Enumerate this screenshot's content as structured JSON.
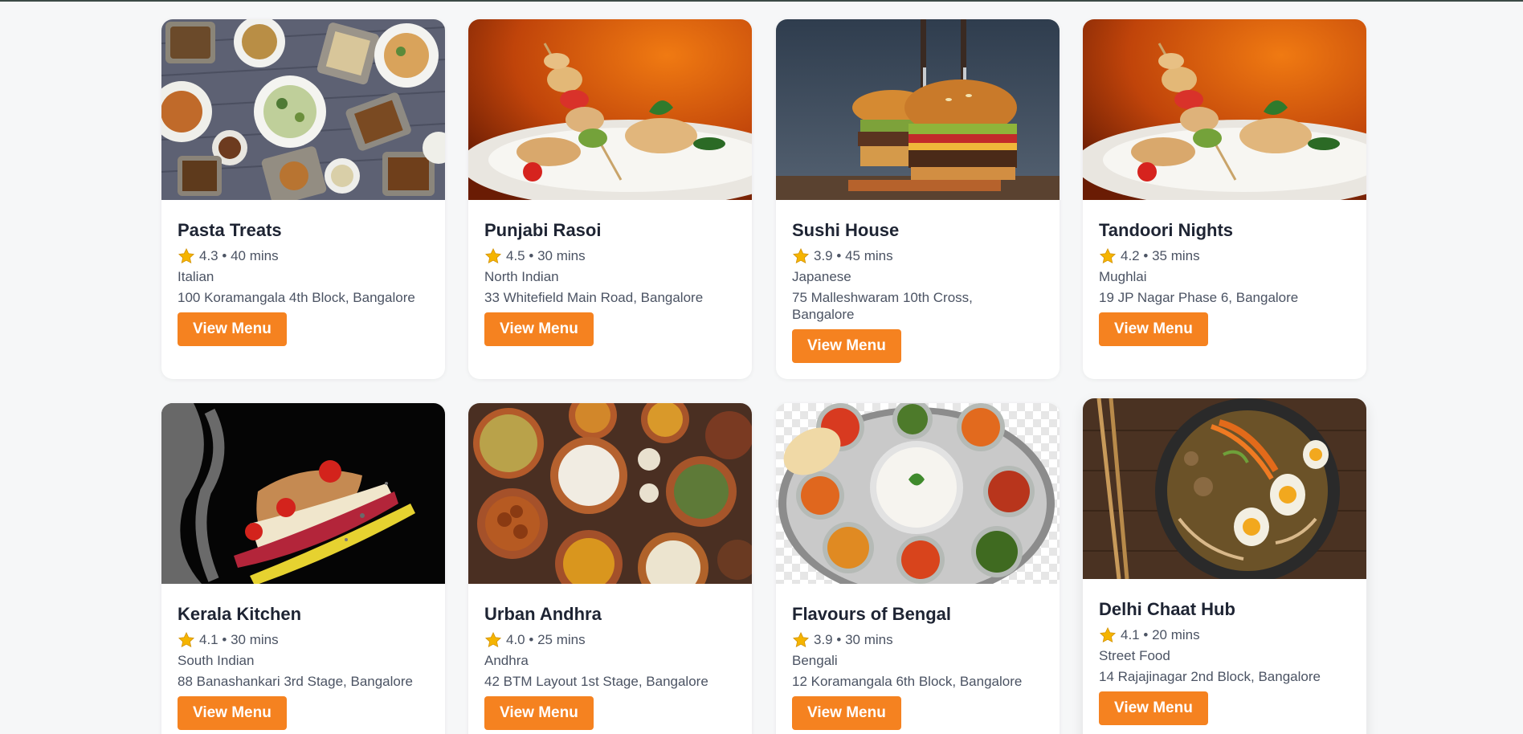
{
  "restaurants": [
    {
      "name": "Pasta Treats",
      "rating": "4.3",
      "time": "40 mins",
      "cuisine": "Italian",
      "address": "100 Koramangala 4th Block, Bangalore",
      "button": "View Menu"
    },
    {
      "name": "Punjabi Rasoi",
      "rating": "4.5",
      "time": "30 mins",
      "cuisine": "North Indian",
      "address": "33 Whitefield Main Road, Bangalore",
      "button": "View Menu"
    },
    {
      "name": "Sushi House",
      "rating": "3.9",
      "time": "45 mins",
      "cuisine": "Japanese",
      "address": "75 Malleshwaram 10th Cross, Bangalore",
      "button": "View Menu"
    },
    {
      "name": "Tandoori Nights",
      "rating": "4.2",
      "time": "35 mins",
      "cuisine": "Mughlai",
      "address": "19 JP Nagar Phase 6, Bangalore",
      "button": "View Menu"
    },
    {
      "name": "Kerala Kitchen",
      "rating": "4.1",
      "time": "30 mins",
      "cuisine": "South Indian",
      "address": "88 Banashankari 3rd Stage, Bangalore",
      "button": "View Menu"
    },
    {
      "name": "Urban Andhra",
      "rating": "4.0",
      "time": "25 mins",
      "cuisine": "Andhra",
      "address": "42 BTM Layout 1st Stage, Bangalore",
      "button": "View Menu"
    },
    {
      "name": "Flavours of Bengal",
      "rating": "3.9",
      "time": "30 mins",
      "cuisine": "Bengali",
      "address": "12 Koramangala 6th Block, Bangalore",
      "button": "View Menu"
    },
    {
      "name": "Delhi Chaat Hub",
      "rating": "4.1",
      "time": "20 mins",
      "cuisine": "Street Food",
      "address": "14 Rajajinagar 2nd Block, Bangalore",
      "button": "View Menu"
    }
  ],
  "meta_separator": "•",
  "icons": {
    "rating": "star-icon"
  },
  "colors": {
    "accent": "#f58220",
    "star": "#f5b400",
    "title": "#1e2433",
    "text": "#4b5363"
  }
}
